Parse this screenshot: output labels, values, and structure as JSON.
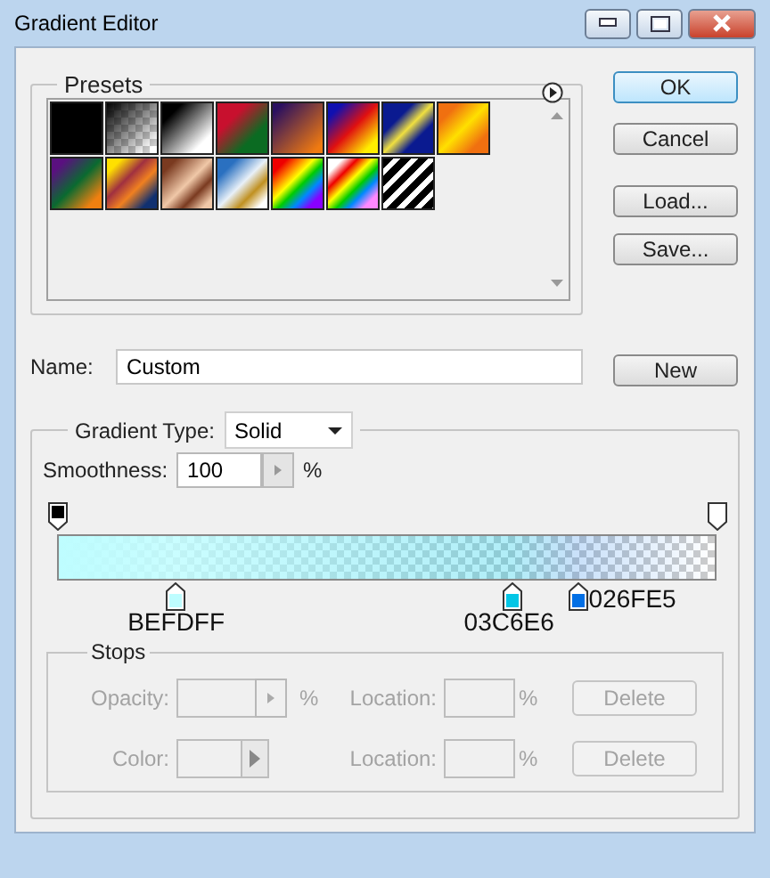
{
  "window": {
    "title": "Gradient Editor"
  },
  "presets": {
    "label": "Presets"
  },
  "buttons": [
    {
      "label": "OK",
      "default": true
    },
    {
      "label": "Cancel",
      "default": false
    },
    {
      "label": "Load...",
      "default": false
    },
    {
      "label": "Save...",
      "default": false
    }
  ],
  "name": {
    "label": "Name:",
    "value": "Custom",
    "button": "New"
  },
  "gradient_type": {
    "label": "Gradient Type:",
    "value": "Solid"
  },
  "smoothness": {
    "label": "Smoothness:",
    "value": "100",
    "unit": "%"
  },
  "opacity_stops": [
    {
      "level": 0,
      "color": "#000000"
    },
    {
      "level": 1,
      "color": "#ffffff"
    }
  ],
  "color_stops": [
    {
      "label": "BEFDFF",
      "color": "#befdff",
      "level": 0.18,
      "kind": "under"
    },
    {
      "label": "03C6E6",
      "color": "#03c6e6",
      "level": 0.69,
      "kind": "under"
    },
    {
      "label": "026FE5",
      "color": "#026fe5",
      "level": 0.79,
      "kind": "side"
    }
  ],
  "stops": {
    "label": "Stops",
    "disabled": true,
    "rows": [
      {
        "kind": "stepper",
        "label": "Opacity:",
        "unit": "%",
        "location_label": "Location:",
        "location_unit": "%",
        "button": "Delete"
      },
      {
        "kind": "swatch",
        "label": "Color:",
        "location_label": "Location:",
        "location_unit": "%",
        "button": "Delete"
      }
    ]
  }
}
